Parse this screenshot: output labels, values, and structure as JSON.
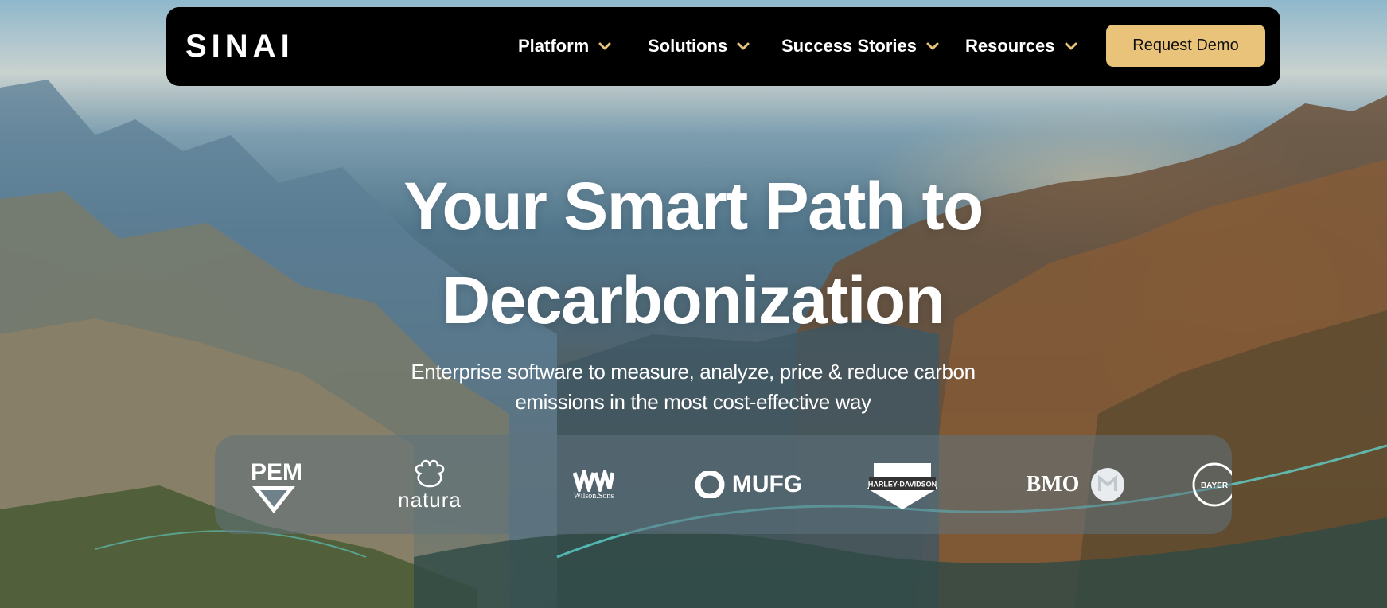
{
  "brand": {
    "logo_text": "SINAI"
  },
  "nav": {
    "items": [
      {
        "label": "Platform",
        "icon": "chevron-down-icon"
      },
      {
        "label": "Solutions",
        "icon": "chevron-down-icon"
      },
      {
        "label": "Success Stories",
        "icon": "chevron-down-icon"
      },
      {
        "label": "Resources",
        "icon": "chevron-down-icon"
      }
    ],
    "cta_label": "Request Demo"
  },
  "hero": {
    "title_line1": "Your Smart Path to",
    "title_line2": "Decarbonization",
    "subtitle_line1": "Enterprise software to measure, analyze, price & reduce carbon",
    "subtitle_line2": "emissions in the most cost-effective way"
  },
  "clients": {
    "pem": "PEM",
    "natura": "natura",
    "wilson_sons": "Wilson.Sons",
    "mufg": "MUFG",
    "harley_davidson": "HARLEY-DAVIDSON",
    "bmo": "BMO",
    "bayer": "BAYER"
  },
  "colors": {
    "nav_bg": "#000000",
    "cta_bg": "#e9c37a",
    "chevron": "#e9c37a",
    "text": "#ffffff"
  }
}
